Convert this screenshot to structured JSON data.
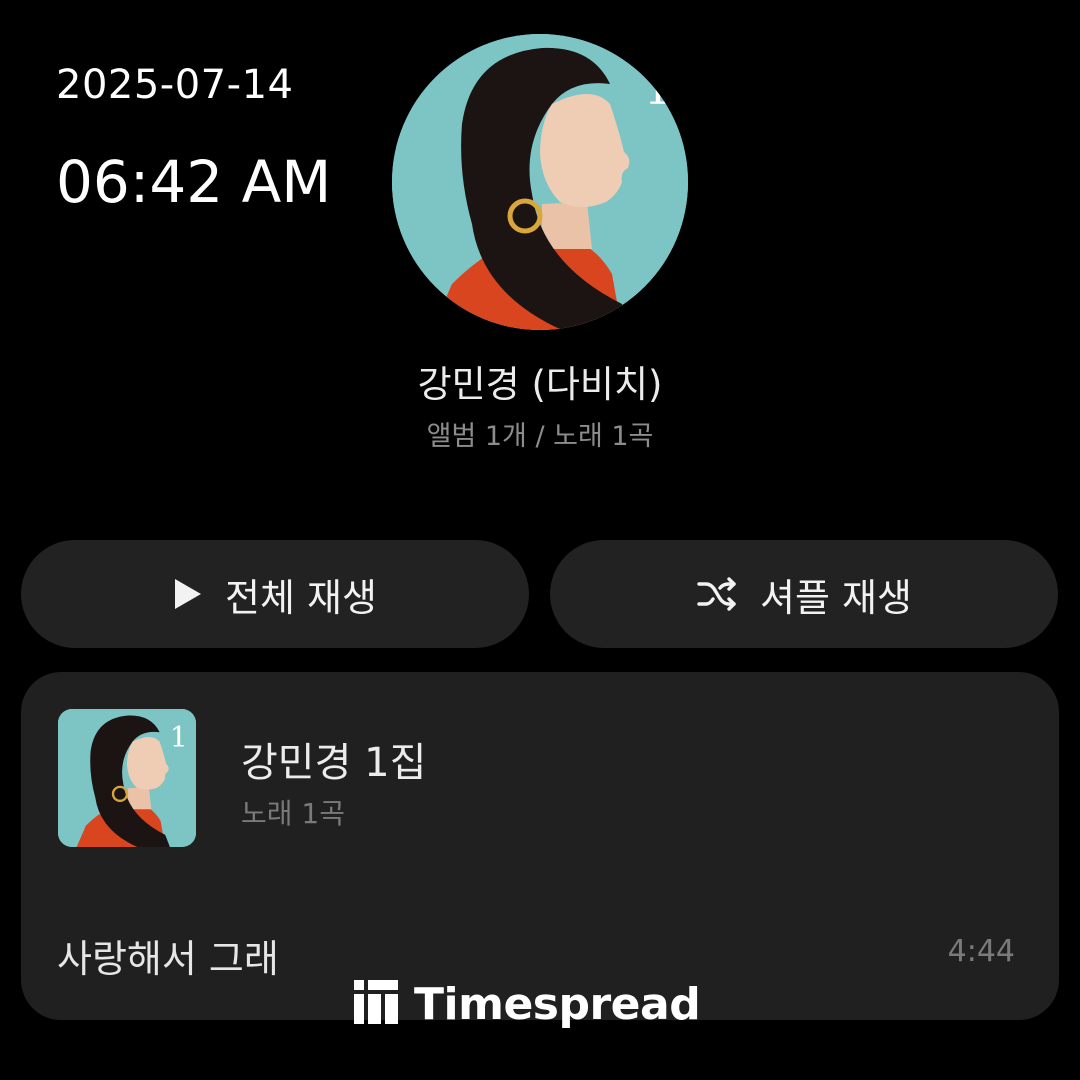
{
  "status": {
    "date": "2025-07-14",
    "time": "06:42 AM"
  },
  "artist": {
    "name": "강민경 (다비치)",
    "meta": "앨범 1개 / 노래 1곡",
    "art_colors": {
      "background": "#7cc5c4",
      "sweater": "#d8451f",
      "hair": "#1c1412"
    }
  },
  "actions": {
    "play_all_label": "전체 재생",
    "shuffle_label": "셔플 재생"
  },
  "album": {
    "title": "강민경 1집",
    "meta": "노래 1곡",
    "songs": [
      {
        "title": "사랑해서 그래",
        "duration": "4:44"
      }
    ]
  },
  "watermark": {
    "text": "Timespread"
  }
}
